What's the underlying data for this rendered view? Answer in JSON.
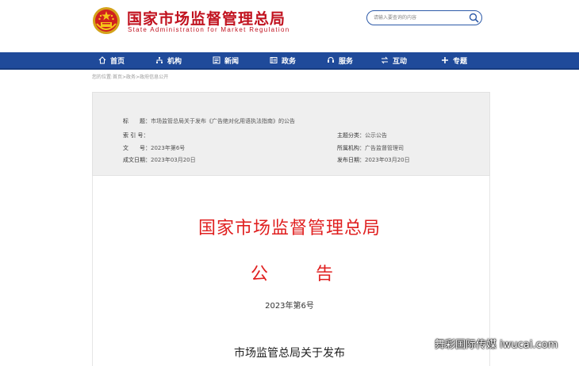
{
  "header": {
    "site_name_cn": "国家市场监督管理总局",
    "site_name_en": "State Administration for Market Regulation",
    "search_placeholder": "请输入要查询的内容",
    "brand_color": "#c1121f"
  },
  "nav": {
    "bg_color": "#1f4a9a",
    "items": [
      {
        "label": "首页",
        "icon": "home-icon"
      },
      {
        "label": "机构",
        "icon": "org-icon"
      },
      {
        "label": "新闻",
        "icon": "news-icon"
      },
      {
        "label": "政务",
        "icon": "gov-icon"
      },
      {
        "label": "服务",
        "icon": "service-icon"
      },
      {
        "label": "互动",
        "icon": "interact-icon"
      },
      {
        "label": "专题",
        "icon": "topic-icon"
      }
    ]
  },
  "breadcrumb": "您的位置:首页>政务>政府信息公开",
  "meta": {
    "title_label": "标　　题：",
    "title_value": "市场监管总局关于发布《广告绝对化用语执法指南》的公告",
    "index_label": "索 引 号：",
    "index_value": "",
    "category_label": "主题分类：",
    "category_value": "公示公告",
    "doc_no_label": "文　　号：",
    "doc_no_value": "2023年第6号",
    "org_label": "所属机构：",
    "org_value": "广告监督管理司",
    "created_label": "成文日期：",
    "created_value": "2023年03月20日",
    "published_label": "发布日期：",
    "published_value": "2023年03月20日"
  },
  "document": {
    "issuer": "国家市场监督管理总局",
    "type_char_1": "公",
    "type_char_2": "告",
    "number": "2023年第6号",
    "title_line1": "市场监管总局关于发布",
    "red_color": "#e02020"
  },
  "watermark": "舞彩国际传媒 iwucai.com"
}
